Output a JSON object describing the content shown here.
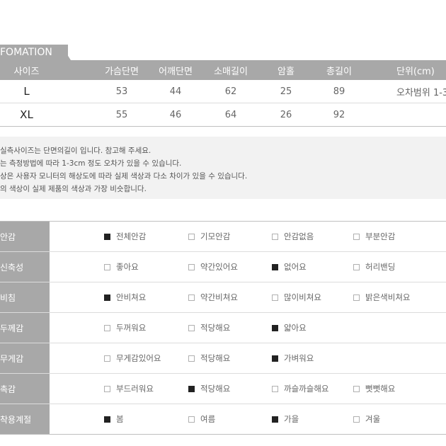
{
  "size_table": {
    "tab_label": "FOMATION",
    "headers": [
      "사이즈",
      "가슴단면",
      "어깨단면",
      "소매길이",
      "암홀",
      "총길이",
      "단위(cm)"
    ],
    "rows": [
      {
        "size": "L",
        "values": [
          "53",
          "44",
          "62",
          "25",
          "89"
        ],
        "note": "오차범위 1-3"
      },
      {
        "size": "XL",
        "values": [
          "55",
          "46",
          "64",
          "26",
          "92"
        ],
        "note": ""
      }
    ]
  },
  "notes": [
    "실측사이즈는 단면의길이 입니다. 참고해 주세요.",
    "는 측정방법에 따라 1-3cm 정도 오차가 있을 수 있습니다.",
    "상은 사용자 모니터의 해상도에 따라 실제 색상과 다소 차이가 있을 수 있습니다.",
    "의 색상이 실제 제품의 색상과 가장 비슷합니다."
  ],
  "product_info": [
    {
      "label": "안감",
      "options": [
        {
          "text": "전체안감",
          "checked": true
        },
        {
          "text": "기모안감",
          "checked": false
        },
        {
          "text": "안감없음",
          "checked": false
        },
        {
          "text": "부분안감",
          "checked": false
        }
      ]
    },
    {
      "label": "신축성",
      "options": [
        {
          "text": "좋아요",
          "checked": false
        },
        {
          "text": "약간있어요",
          "checked": false
        },
        {
          "text": "없어요",
          "checked": true
        },
        {
          "text": "허리밴딩",
          "checked": false
        }
      ]
    },
    {
      "label": "비침",
      "options": [
        {
          "text": "안비쳐요",
          "checked": true
        },
        {
          "text": "약간비쳐요",
          "checked": false
        },
        {
          "text": "많이비쳐요",
          "checked": false
        },
        {
          "text": "밝은색비쳐요",
          "checked": false
        }
      ]
    },
    {
      "label": "두께감",
      "options": [
        {
          "text": "두꺼워요",
          "checked": false
        },
        {
          "text": "적당해요",
          "checked": false
        },
        {
          "text": "얇아요",
          "checked": true
        }
      ]
    },
    {
      "label": "무게감",
      "options": [
        {
          "text": "무게감있어요",
          "checked": false
        },
        {
          "text": "적당해요",
          "checked": false
        },
        {
          "text": "가벼워요",
          "checked": true
        }
      ]
    },
    {
      "label": "촉감",
      "options": [
        {
          "text": "부드러워요",
          "checked": false
        },
        {
          "text": "적당해요",
          "checked": true
        },
        {
          "text": "까슬까슬해요",
          "checked": false
        },
        {
          "text": "뻣뻣해요",
          "checked": false
        }
      ]
    },
    {
      "label": "착용계절",
      "options": [
        {
          "text": "봄",
          "checked": true
        },
        {
          "text": "여름",
          "checked": false
        },
        {
          "text": "가을",
          "checked": true
        },
        {
          "text": "겨울",
          "checked": false
        }
      ]
    }
  ],
  "colors": {
    "header_gray": "#a8a8a8",
    "notes_bg": "#f2f2f2",
    "checked": "#222222"
  }
}
